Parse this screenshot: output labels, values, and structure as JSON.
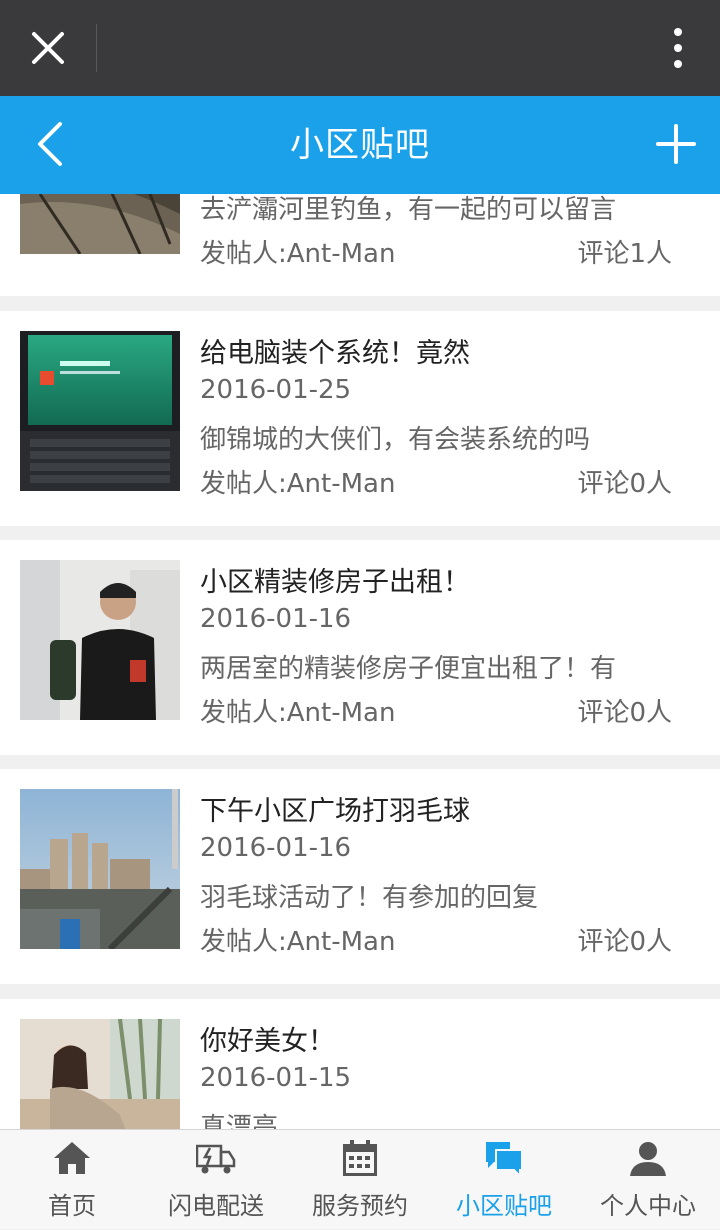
{
  "header": {
    "title": "小区贴吧"
  },
  "posts": [
    {
      "title": "",
      "date": "",
      "desc": "去浐灞河里钓鱼，有一起的可以留言",
      "author": "发帖人:Ant-Man",
      "comments": "评论1人"
    },
    {
      "title": "给电脑装个系统！竟然",
      "date": "2016-01-25",
      "desc": "御锦城的大侠们，有会装系统的吗",
      "author": "发帖人:Ant-Man",
      "comments": "评论0人"
    },
    {
      "title": "小区精装修房子出租！",
      "date": "2016-01-16",
      "desc": "两居室的精装修房子便宜出租了！有",
      "author": "发帖人:Ant-Man",
      "comments": "评论0人"
    },
    {
      "title": "下午小区广场打羽毛球",
      "date": "2016-01-16",
      "desc": "羽毛球活动了！有参加的回复",
      "author": "发帖人:Ant-Man",
      "comments": "评论0人"
    },
    {
      "title": "你好美女！",
      "date": "2016-01-15",
      "desc": "真漂亮",
      "author": "",
      "comments": ""
    }
  ],
  "nav": [
    {
      "label": "首页",
      "icon": "home-icon"
    },
    {
      "label": "闪电配送",
      "icon": "delivery-truck-icon"
    },
    {
      "label": "服务预约",
      "icon": "calendar-icon"
    },
    {
      "label": "小区贴吧",
      "icon": "chat-bubbles-icon",
      "active": true
    },
    {
      "label": "个人中心",
      "icon": "user-icon"
    }
  ],
  "colors": {
    "accent": "#1aa1e9",
    "topbar": "#3a3a3c"
  }
}
